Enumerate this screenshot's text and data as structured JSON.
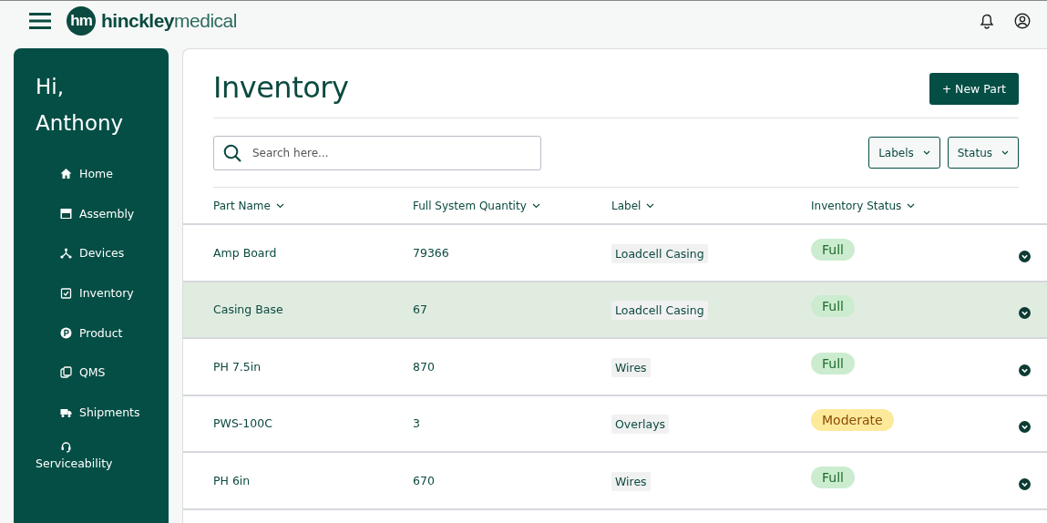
{
  "topbar": {
    "logo": {
      "mark": "hm",
      "name_bold": "hinckley",
      "name_light": "medical"
    }
  },
  "sidebar": {
    "greeting": [
      "Hi,",
      "Anthony"
    ],
    "items": [
      {
        "label": "Home",
        "stacked": false
      },
      {
        "label": "Assembly",
        "stacked": false
      },
      {
        "label": "Devices",
        "stacked": false
      },
      {
        "label": "Inventory",
        "stacked": false
      },
      {
        "label": "Product",
        "stacked": false
      },
      {
        "label": "QMS",
        "stacked": false
      },
      {
        "label": "Shipments",
        "stacked": false
      },
      {
        "label": "Serviceability",
        "stacked": true
      }
    ]
  },
  "page": {
    "title": "Inventory",
    "new_button": "+ New Part",
    "search": {
      "placeholder": "Search here..."
    },
    "filters": [
      "Labels",
      "Status"
    ]
  },
  "table": {
    "columns": [
      "Part Name",
      "Full System Quantity",
      "Label",
      "Inventory Status"
    ],
    "rows": [
      {
        "name": "Amp Board",
        "quantity": "79366",
        "label": "Loadcell Casing",
        "status": "Full",
        "kind": "full",
        "selected": false
      },
      {
        "name": "Casing Base",
        "quantity": "67",
        "label": "Loadcell Casing",
        "status": "Full",
        "kind": "full",
        "selected": true
      },
      {
        "name": "PH 7.5in",
        "quantity": "870",
        "label": "Wires",
        "status": "Full",
        "kind": "full",
        "selected": false
      },
      {
        "name": "PWS-100C",
        "quantity": "3",
        "label": "Overlays",
        "status": "Moderate",
        "kind": "moderate",
        "selected": false
      },
      {
        "name": "PH 6in",
        "quantity": "670",
        "label": "Wires",
        "status": "Full",
        "kind": "full",
        "selected": false
      }
    ]
  }
}
